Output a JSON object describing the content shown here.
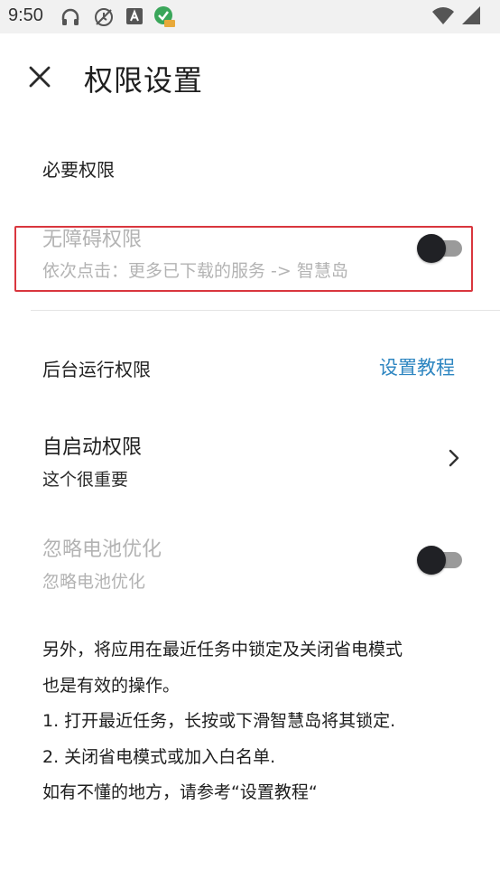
{
  "status_bar": {
    "time": "9:50",
    "icons": [
      "headphones-icon",
      "location-off-icon",
      "a-badge-icon",
      "app-notification-icon",
      "wifi-icon",
      "signal-icon"
    ]
  },
  "app_bar": {
    "close_icon": "close-icon",
    "title": "权限设置"
  },
  "required_permissions": {
    "header": "必要权限",
    "accessibility": {
      "title": "无障碍权限",
      "subtitle": "依次点击：更多已下载的服务 -> 智慧岛",
      "toggle_on": false,
      "enabled": false
    }
  },
  "background_permissions": {
    "header": "后台运行权限",
    "tutorial_link": "设置教程",
    "autostart": {
      "title": "自启动权限",
      "subtitle": "这个很重要"
    },
    "battery": {
      "title": "忽略电池优化",
      "subtitle": "忽略电池优化",
      "toggle_on": false,
      "enabled": false
    }
  },
  "notes": {
    "line1": "另外，将应用在最近任务中锁定及关闭省电模式",
    "line2": "也是有效的操作。",
    "line3": "1. 打开最近任务，长按或下滑智慧岛将其锁定.",
    "line4": "2. 关闭省电模式或加入白名单.",
    "line5": "如有不懂的地方，请参考“设置教程“"
  },
  "colors": {
    "accent_link": "#2e86c1",
    "highlight_border": "#d9363e",
    "disabled_text": "#b3b3b3"
  }
}
